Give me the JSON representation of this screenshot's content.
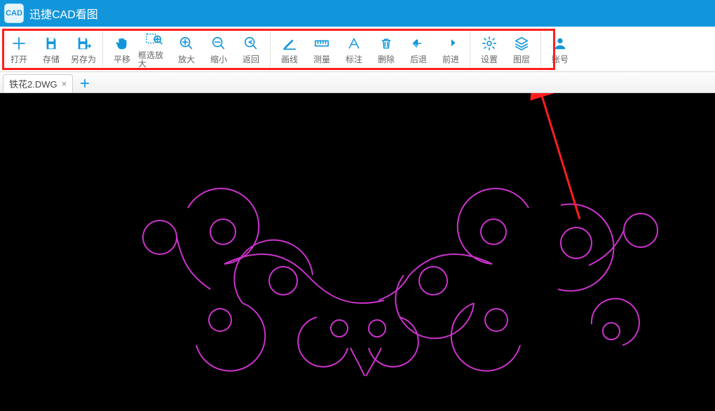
{
  "app": {
    "icon_text": "CAD",
    "title": "迅捷CAD看图"
  },
  "toolbar": {
    "groups": [
      {
        "items": [
          {
            "name": "open-button",
            "icon": "plus",
            "label": "打开"
          },
          {
            "name": "save-button",
            "icon": "save",
            "label": "存储"
          },
          {
            "name": "save-as-button",
            "icon": "save-as",
            "label": "另存为"
          }
        ]
      },
      {
        "items": [
          {
            "name": "pan-button",
            "icon": "hand",
            "label": "平移"
          },
          {
            "name": "zoom-window-button",
            "icon": "zoom-box",
            "label": "框选放大"
          },
          {
            "name": "zoom-in-button",
            "icon": "zoom-in",
            "label": "放大"
          },
          {
            "name": "zoom-out-button",
            "icon": "zoom-out",
            "label": "缩小"
          },
          {
            "name": "back-button",
            "icon": "zoom-rev",
            "label": "返回"
          }
        ]
      },
      {
        "items": [
          {
            "name": "draw-line-button",
            "icon": "pencil",
            "label": "画线"
          },
          {
            "name": "measure-button",
            "icon": "ruler",
            "label": "测量"
          },
          {
            "name": "annotate-button",
            "icon": "text-a",
            "label": "标注"
          },
          {
            "name": "delete-button",
            "icon": "trash",
            "label": "删除"
          },
          {
            "name": "undo-button",
            "icon": "undo",
            "label": "后退"
          },
          {
            "name": "redo-button",
            "icon": "redo",
            "label": "前进"
          }
        ]
      },
      {
        "items": [
          {
            "name": "settings-button",
            "icon": "gear",
            "label": "设置"
          },
          {
            "name": "layers-button",
            "icon": "layers",
            "label": "图层"
          }
        ]
      },
      {
        "items": [
          {
            "name": "account-button",
            "icon": "user",
            "label": "账号"
          }
        ]
      }
    ]
  },
  "tabs": {
    "items": [
      {
        "label": "铁花2.DWG"
      }
    ]
  },
  "colors": {
    "accent": "#1296db",
    "annotation": "#ff1e1e",
    "drawing_stroke": "#cc33cc"
  }
}
